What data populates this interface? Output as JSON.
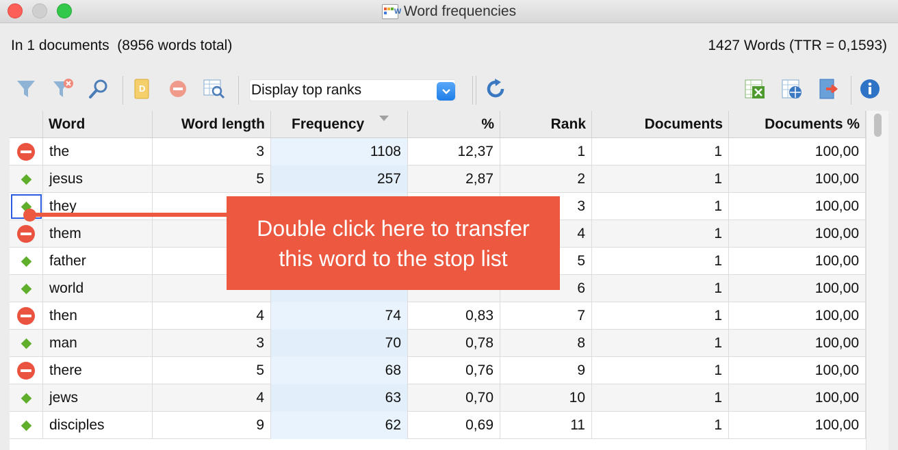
{
  "window": {
    "title": "Word frequencies"
  },
  "info": {
    "left": "In 1 documents  (8956 words total)",
    "right": "1427 Words (TTR = 0,1593)"
  },
  "toolbar": {
    "display_select": "Display top ranks",
    "icons": [
      "filter-icon",
      "filter-clear-icon",
      "search-icon",
      "dictionary-icon",
      "stop-list-icon",
      "zoom-table-icon",
      "refresh-icon",
      "export-excel-icon",
      "export-html-icon",
      "export-file-icon",
      "info-icon"
    ]
  },
  "table": {
    "headers": [
      "Word",
      "Word length",
      "Frequency",
      "%",
      "Rank",
      "Documents",
      "Documents %"
    ],
    "rows": [
      {
        "status": "stop",
        "word": "the",
        "length": "3",
        "freq": "1108",
        "pct": "12,37",
        "rank": "1",
        "docs": "1",
        "docs_pct": "100,00"
      },
      {
        "status": "go",
        "word": "jesus",
        "length": "5",
        "freq": "257",
        "pct": "2,87",
        "rank": "2",
        "docs": "1",
        "docs_pct": "100,00"
      },
      {
        "status": "go",
        "word": "they",
        "length": "",
        "freq": "",
        "pct": "",
        "rank": "3",
        "docs": "1",
        "docs_pct": "100,00"
      },
      {
        "status": "stop",
        "word": "them",
        "length": "",
        "freq": "",
        "pct": "",
        "rank": "4",
        "docs": "1",
        "docs_pct": "100,00"
      },
      {
        "status": "go",
        "word": "father",
        "length": "",
        "freq": "",
        "pct": "",
        "rank": "5",
        "docs": "1",
        "docs_pct": "100,00"
      },
      {
        "status": "go",
        "word": "world",
        "length": "",
        "freq": "",
        "pct": "",
        "rank": "6",
        "docs": "1",
        "docs_pct": "100,00"
      },
      {
        "status": "stop",
        "word": "then",
        "length": "4",
        "freq": "74",
        "pct": "0,83",
        "rank": "7",
        "docs": "1",
        "docs_pct": "100,00"
      },
      {
        "status": "go",
        "word": "man",
        "length": "3",
        "freq": "70",
        "pct": "0,78",
        "rank": "8",
        "docs": "1",
        "docs_pct": "100,00"
      },
      {
        "status": "stop",
        "word": "there",
        "length": "5",
        "freq": "68",
        "pct": "0,76",
        "rank": "9",
        "docs": "1",
        "docs_pct": "100,00"
      },
      {
        "status": "go",
        "word": "jews",
        "length": "4",
        "freq": "63",
        "pct": "0,70",
        "rank": "10",
        "docs": "1",
        "docs_pct": "100,00"
      },
      {
        "status": "go",
        "word": "disciples",
        "length": "9",
        "freq": "62",
        "pct": "0,69",
        "rank": "11",
        "docs": "1",
        "docs_pct": "100,00"
      }
    ]
  },
  "callout": {
    "line1": "Double click here to transfer",
    "line2": "this word to the stop list"
  },
  "colors": {
    "accent": "#ec5840",
    "stop": "#e9533f",
    "go": "#5fae2c",
    "selection": "#2a5be0"
  }
}
